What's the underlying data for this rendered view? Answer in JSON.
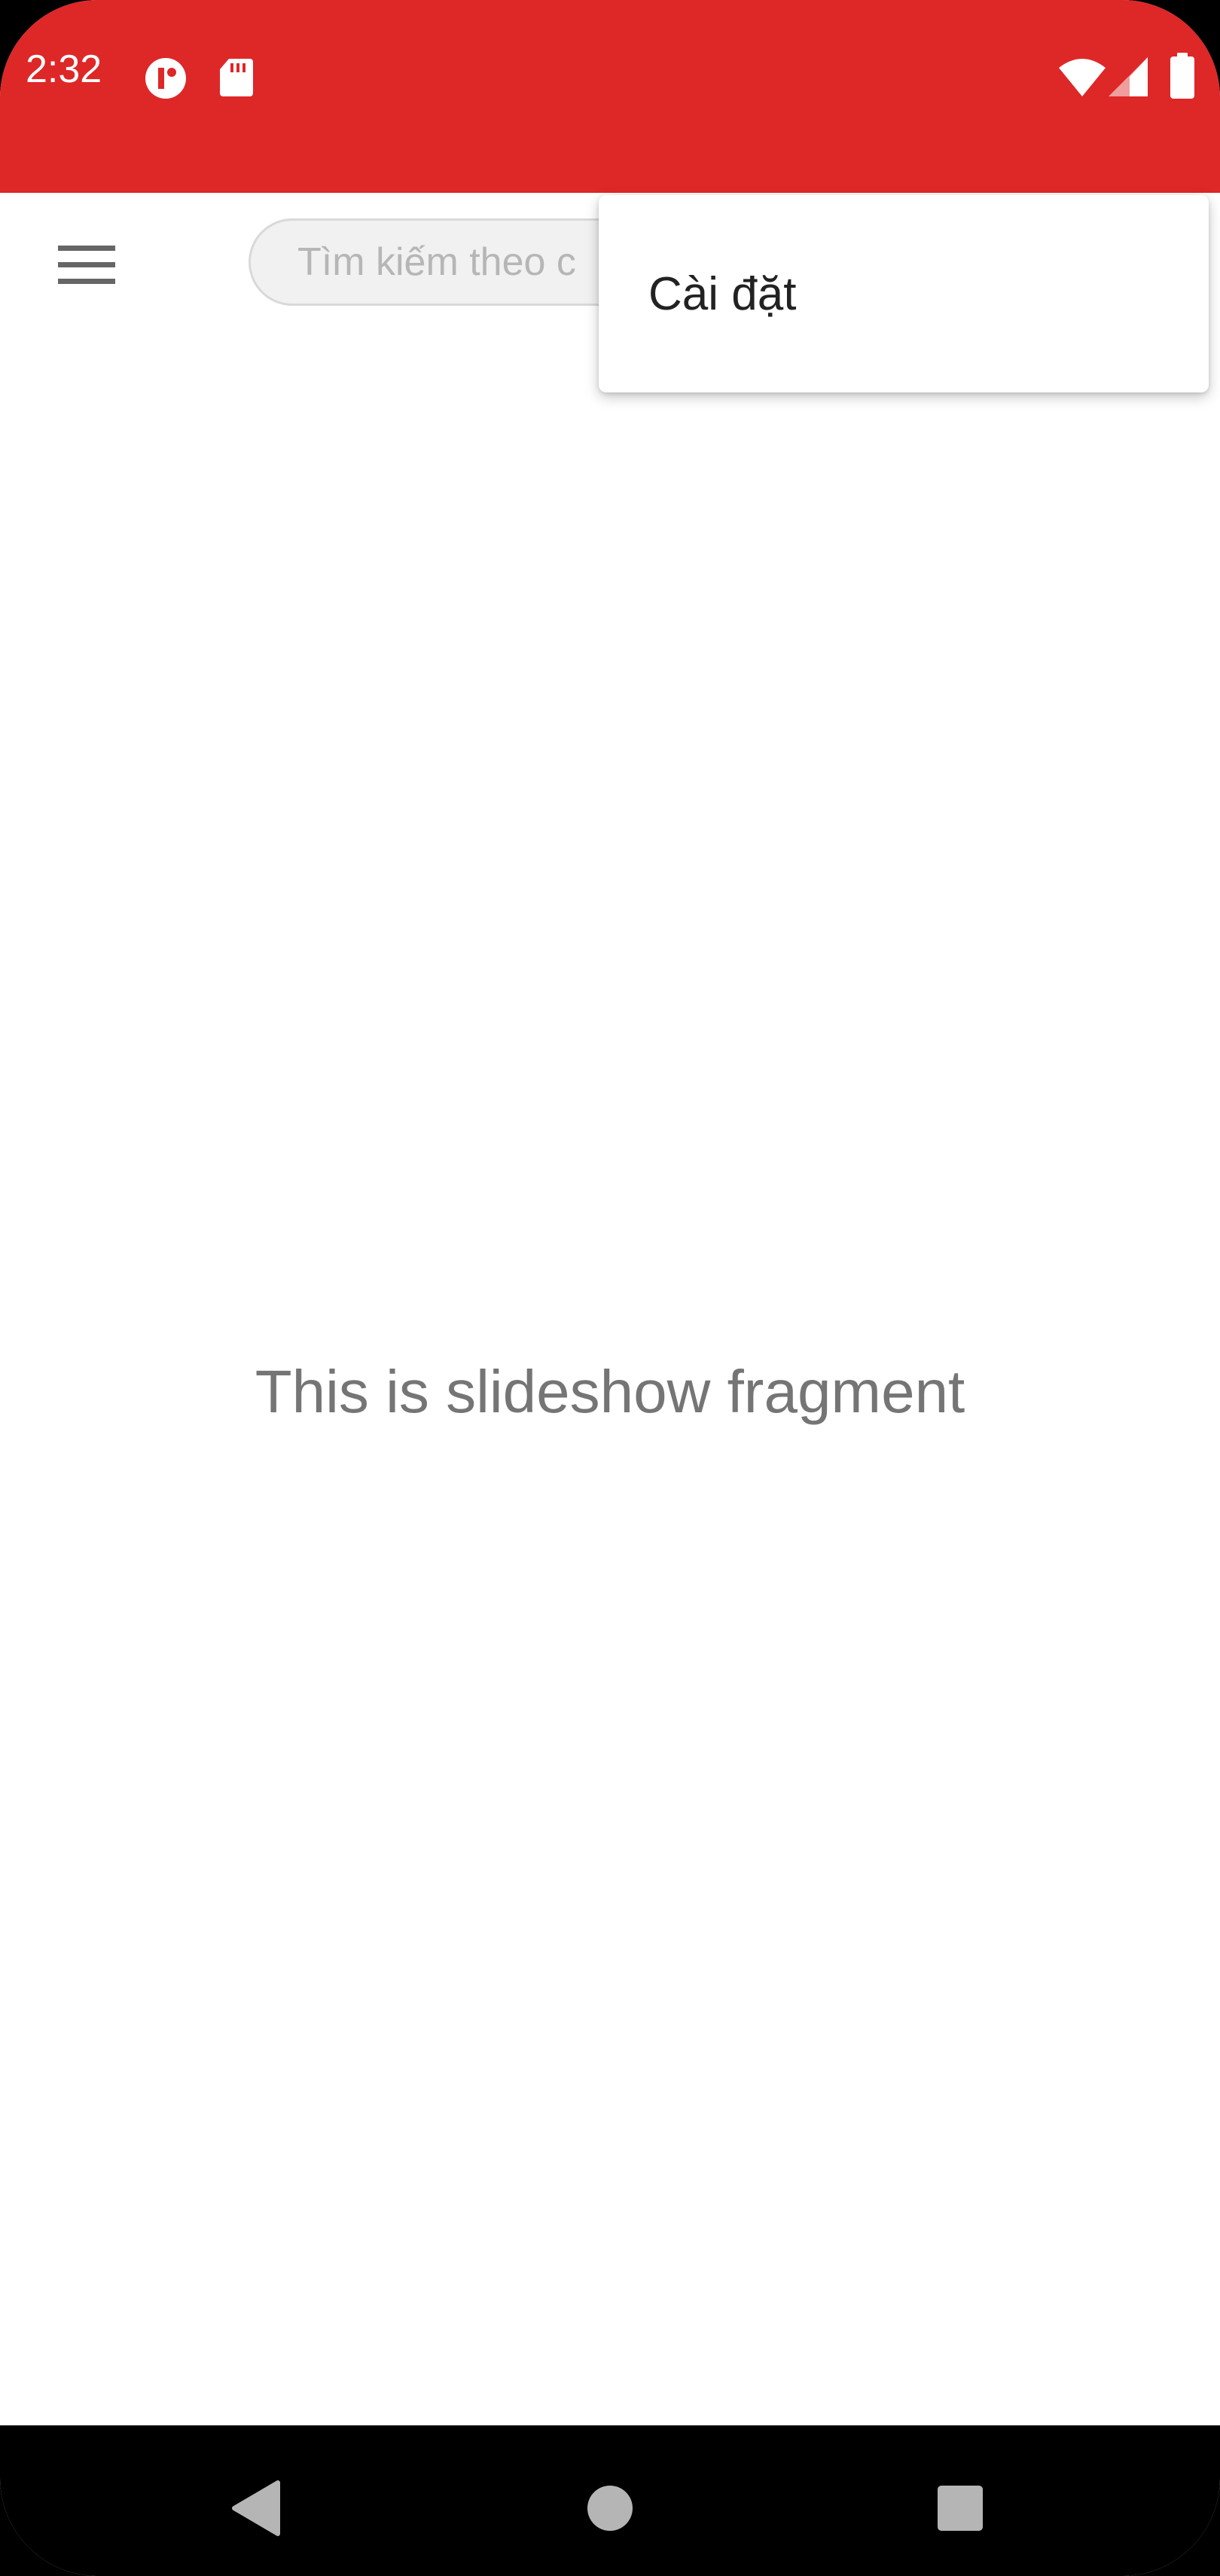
{
  "status_bar": {
    "time": "2:32",
    "background_color": "#de2727",
    "left_icons": [
      "app-notification-icon",
      "sd-card-icon"
    ],
    "right_icons": [
      "wifi-icon",
      "cell-signal-icon",
      "battery-icon"
    ]
  },
  "toolbar": {
    "menu_icon": "hamburger-menu-icon",
    "search_placeholder": "Tìm kiếm theo c"
  },
  "popup_menu": {
    "items": [
      {
        "label": "Cài đặt"
      }
    ]
  },
  "main": {
    "fragment_text": "This is slideshow fragment"
  },
  "nav_bar": {
    "buttons": [
      "back-icon",
      "home-icon",
      "recents-icon"
    ]
  }
}
